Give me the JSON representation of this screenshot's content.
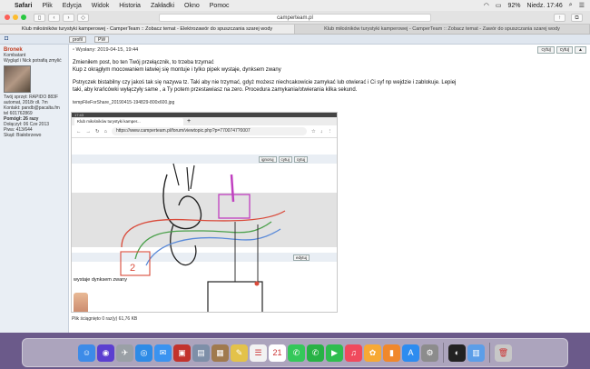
{
  "menubar": {
    "app": "Safari",
    "items": [
      "Plik",
      "Edycja",
      "Widok",
      "Historia",
      "Zakładki",
      "Okno",
      "Pomoc"
    ],
    "battery": "92%",
    "clock": "Niedz. 17:46"
  },
  "toolbar": {
    "url": "camperteam.pl"
  },
  "tabs": [
    {
      "label": "Klub miłośników turystyki kamperowej - CamperTeam :: Zobacz temat - Elektrozawór do spuszczania szarej wody",
      "active": true
    },
    {
      "label": "Klub miłośników turystyki kamperowej - CamperTeam :: Zobacz temat - Zawór do spuszczania szarej wody",
      "active": false
    }
  ],
  "topbar": {
    "profile": "profil",
    "pw": "PW"
  },
  "user": {
    "name": "Bronek",
    "rank": "Kombatant",
    "status": "Wygląd i Nick potrafią zmylić",
    "details": [
      "Twój sprzęt: RAPIDO 883F",
      "automat, 2018r dł. 7m",
      "Kontakt: pandb@pacalta.fm",
      "tel 601762869"
    ],
    "pomogl": "Pomógł: 26 razy",
    "joined": "Dołączył: 06 Cze 2013",
    "piwa": "Piwa: 413/644",
    "from": "Skąd: Białobrzewo"
  },
  "post": {
    "meta": "Wysłany: 2019-04-15, 19:44",
    "reply": "cytuj",
    "quote": "cytuj",
    "para1": [
      "Zmieniłem post, bo ten Twój przełącznik, to trzeba trzymać",
      "Kup z okrągłym mocowaniem łatwiej się montuje i tylko pipek wystaje, dynksem zwany"
    ],
    "para2": [
      "Pstryczek bistabilny czy jakoś tak się nazywa tz. Taki aby nie trzymać, gdyż możesz niechcakowicie zamykać lub otwierać i Ci syf np wejdzie i zablokuje. Lepiej",
      "taki, aby krańcówki wyłączyły same , a Ty potem przestawiasz na zero. Procedura zamykania/otwierania kilka sekund."
    ],
    "file": "tempFileForShare_20190415-194829-800x600.jpg",
    "footer": "Plik ściągnięto 0 raz(y) 61,76 KB"
  },
  "shot": {
    "status": "17:43",
    "tab": "Klub miłośników turystyki kamper...",
    "url": "https://www.camperteam.pl/forum/viewtopic.php?p=7700747?0007",
    "btn1": "ignoruj",
    "btn2": "cytuj",
    "btn3": "cytuj",
    "btn4": "edytuj",
    "caption": "wystaje dynksem zwany"
  },
  "dock": [
    {
      "name": "finder",
      "glyph": "☺",
      "color": "#3d8be8"
    },
    {
      "name": "siri",
      "glyph": "◉",
      "color": "#5b3fd0"
    },
    {
      "name": "launchpad",
      "glyph": "✈",
      "color": "#9aa0a6"
    },
    {
      "name": "safari",
      "glyph": "◎",
      "color": "#2e8be6"
    },
    {
      "name": "mail",
      "glyph": "✉",
      "color": "#3b93f0"
    },
    {
      "name": "photo-booth",
      "glyph": "▣",
      "color": "#c2332d"
    },
    {
      "name": "preview",
      "glyph": "▤",
      "color": "#7e8fa8"
    },
    {
      "name": "contacts",
      "glyph": "▦",
      "color": "#a07a4e"
    },
    {
      "name": "notes",
      "glyph": "✎",
      "color": "#e3c24a"
    },
    {
      "name": "reminders",
      "glyph": "☰",
      "color": "#f2f2f2"
    },
    {
      "name": "calendar",
      "glyph": "21",
      "color": "#ffffff"
    },
    {
      "name": "messages",
      "glyph": "✆",
      "color": "#34c85a"
    },
    {
      "name": "whatsapp",
      "glyph": "✆",
      "color": "#27b245"
    },
    {
      "name": "facetime",
      "glyph": "▶",
      "color": "#2fbd4f"
    },
    {
      "name": "music",
      "glyph": "♫",
      "color": "#f04a5d"
    },
    {
      "name": "photos",
      "glyph": "✿",
      "color": "#f7a935"
    },
    {
      "name": "books",
      "glyph": "▮",
      "color": "#f0882c"
    },
    {
      "name": "app-store",
      "glyph": "A",
      "color": "#2d8cf0"
    },
    {
      "name": "system-preferences",
      "glyph": "⚙",
      "color": "#8c8c8c"
    },
    {
      "name": "screenshot",
      "glyph": "◐",
      "color": "#222222"
    },
    {
      "name": "downloads",
      "glyph": "▥",
      "color": "#5c9ee8"
    },
    {
      "name": "trash",
      "glyph": "🗑",
      "color": "#c7c7c7"
    }
  ]
}
